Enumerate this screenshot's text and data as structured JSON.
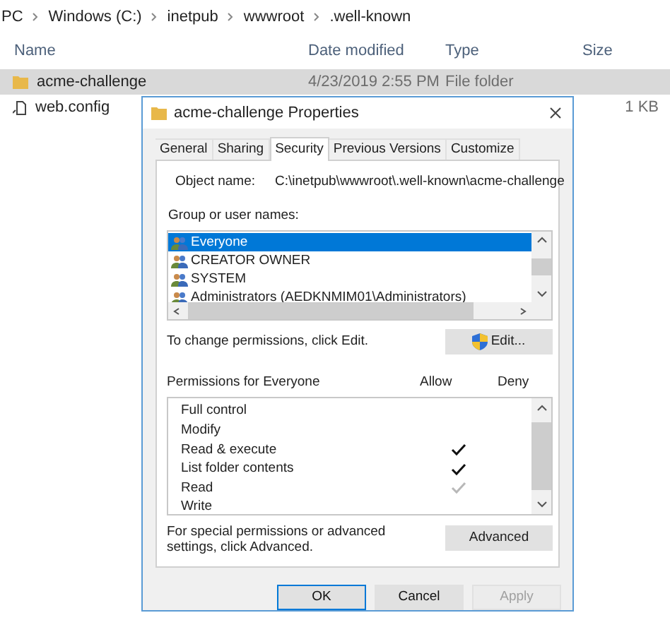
{
  "breadcrumb": [
    "PC",
    "Windows (C:)",
    "inetpub",
    "wwwroot",
    ".well-known"
  ],
  "file_list": {
    "columns": [
      "Name",
      "Date modified",
      "Type",
      "Size"
    ],
    "rows": [
      {
        "name": "acme-challenge",
        "kind": "folder",
        "date": "4/23/2019 2:55 PM",
        "type": "File folder",
        "size": "",
        "selected": true
      },
      {
        "name": "web.config",
        "kind": "file",
        "date": "",
        "type": "",
        "size": "1 KB",
        "selected": false
      }
    ]
  },
  "dialog": {
    "title": "acme-challenge Properties",
    "tabs": [
      {
        "label": "General",
        "selected": false
      },
      {
        "label": "Sharing",
        "selected": false
      },
      {
        "label": "Security",
        "selected": true
      },
      {
        "label": "Previous Versions",
        "selected": false
      },
      {
        "label": "Customize",
        "selected": false
      }
    ],
    "object_name_label": "Object name:",
    "object_name": "C:\\inetpub\\wwwroot\\.well-known\\acme-challenge",
    "group_label": "Group or user names:",
    "users": [
      {
        "name": "Everyone",
        "selected": true
      },
      {
        "name": "CREATOR OWNER",
        "selected": false
      },
      {
        "name": "SYSTEM",
        "selected": false
      },
      {
        "name": "Administrators (AEDKNMIM01\\Administrators)",
        "selected": false
      }
    ],
    "change_hint": "To change permissions, click Edit.",
    "edit_button": "Edit...",
    "permissions_label": "Permissions for Everyone",
    "allow_header": "Allow",
    "deny_header": "Deny",
    "permissions": [
      {
        "name": "Full control",
        "allow": false
      },
      {
        "name": "Modify",
        "allow": false
      },
      {
        "name": "Read & execute",
        "allow": true,
        "inherited": false
      },
      {
        "name": "List folder contents",
        "allow": true,
        "inherited": false
      },
      {
        "name": "Read",
        "allow": true,
        "inherited": true
      },
      {
        "name": "Write",
        "allow": false
      }
    ],
    "advanced_hint": "For special permissions or advanced settings, click Advanced.",
    "advanced_button": "Advanced",
    "buttons": [
      {
        "label": "OK",
        "default": true,
        "disabled": false
      },
      {
        "label": "Cancel",
        "default": false,
        "disabled": false
      },
      {
        "label": "Apply",
        "default": false,
        "disabled": true
      }
    ]
  }
}
